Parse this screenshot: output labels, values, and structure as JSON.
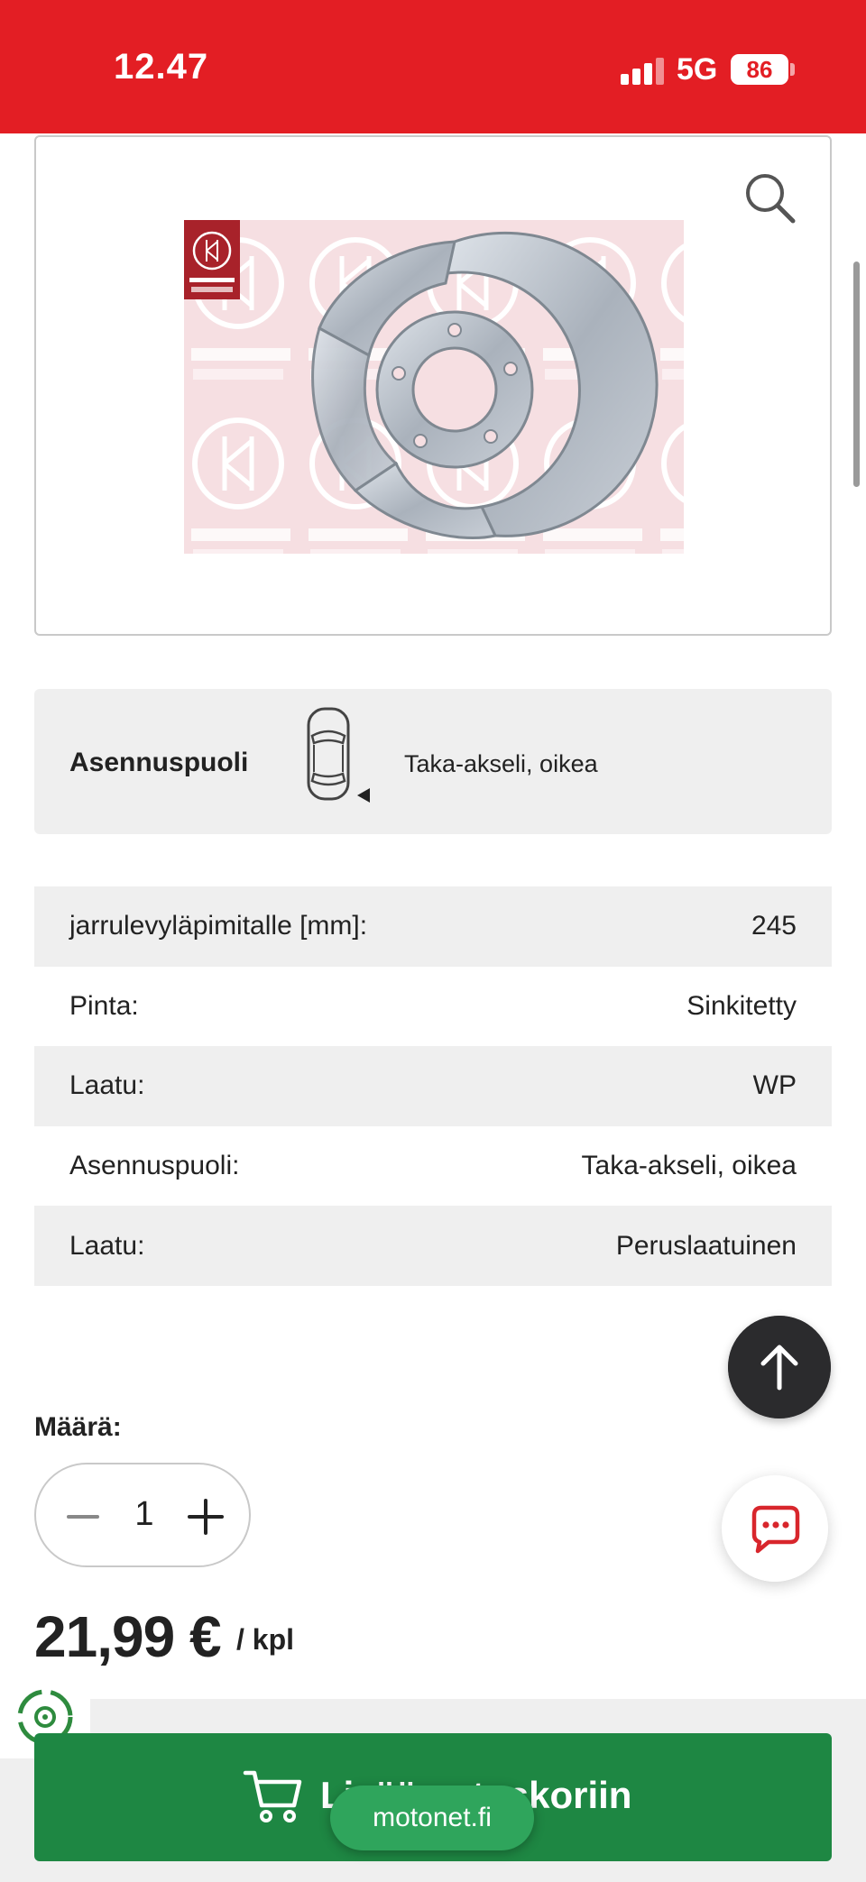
{
  "status_bar": {
    "time": "12.47",
    "network": "5G",
    "battery": "86"
  },
  "product_image": {
    "brand": "KLOKKERHOLM"
  },
  "mounting_side": {
    "label": "Asennuspuoli",
    "value": "Taka-akseli, oikea"
  },
  "specs": [
    {
      "label": "jarrulevyläpimitalle [mm]:",
      "value": "245"
    },
    {
      "label": "Pinta:",
      "value": "Sinkitetty"
    },
    {
      "label": "Laatu:",
      "value": "WP"
    },
    {
      "label": "Asennuspuoli:",
      "value": "Taka-akseli, oikea"
    },
    {
      "label": "Laatu:",
      "value": "Peruslaatuinen"
    }
  ],
  "quantity": {
    "label": "Määrä:",
    "value": "1"
  },
  "price": {
    "amount": "21,99 €",
    "unit": "/ kpl"
  },
  "cart_button": {
    "label": "Lisää ostoskoriin"
  },
  "url_pill": "motonet.fi",
  "colors": {
    "brand_red": "#e31e24",
    "cart_green": "#1e8743",
    "pill_green": "#2fa55c",
    "row_shade": "#efefef"
  }
}
